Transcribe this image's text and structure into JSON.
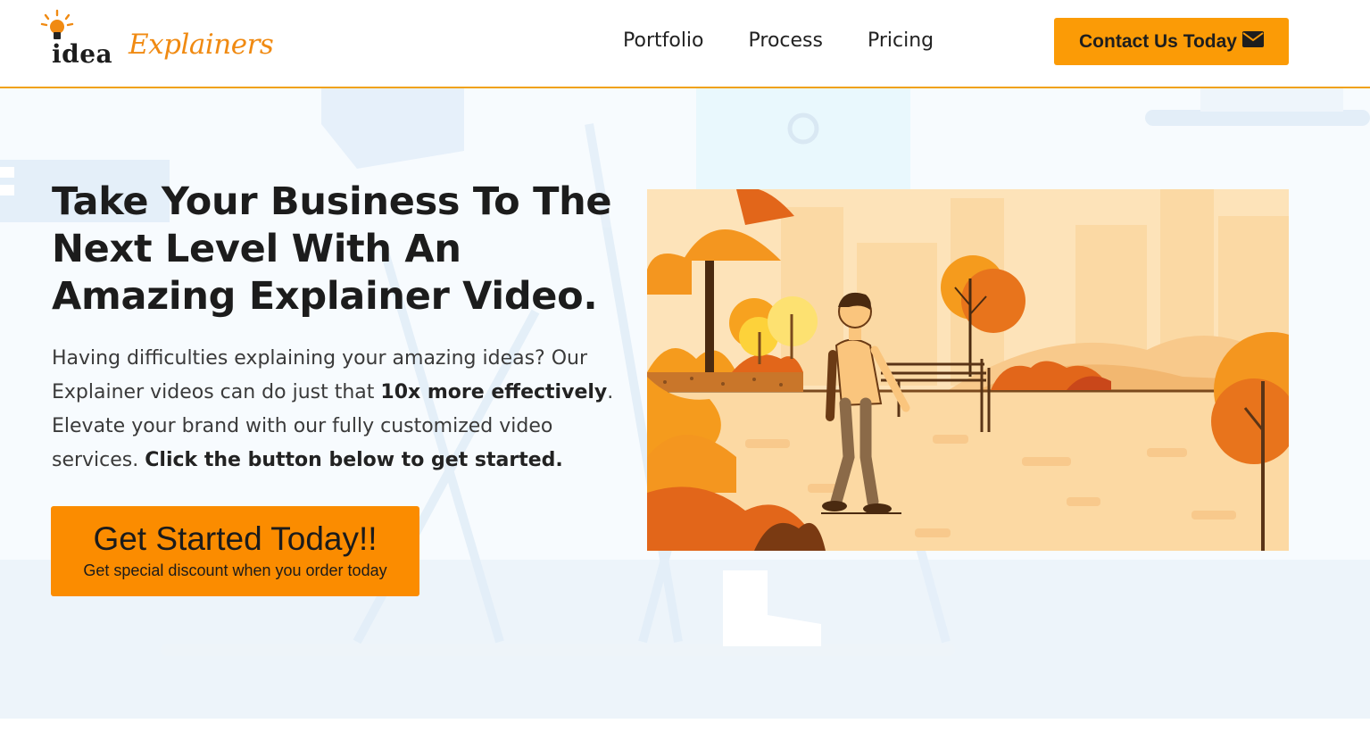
{
  "brand": {
    "logo_part1": "idea",
    "logo_part2": "Explainers",
    "accent_color": "#fb9b06",
    "text_color": "#1c1c1c"
  },
  "nav": {
    "items": [
      "Portfolio",
      "Process",
      "Pricing"
    ]
  },
  "header_cta": {
    "label": "Contact Us Today",
    "icon": "envelope-icon"
  },
  "hero": {
    "headline": "Take Your Business To The Next Level With An Amazing Explainer Video.",
    "intro_part1": "Having difficulties explaining your amazing ideas? Our Explainer videos can do just that ",
    "intro_bold1": "10x more effectively",
    "intro_part2": ". Elevate your brand with our fully customized video services. ",
    "intro_bold2": "Click the button below to get started.",
    "button_label": "Get Started Today!!",
    "button_sublabel": "Get special discount when you order today",
    "video_icon": "autumn-park-animation-thumbnail"
  }
}
